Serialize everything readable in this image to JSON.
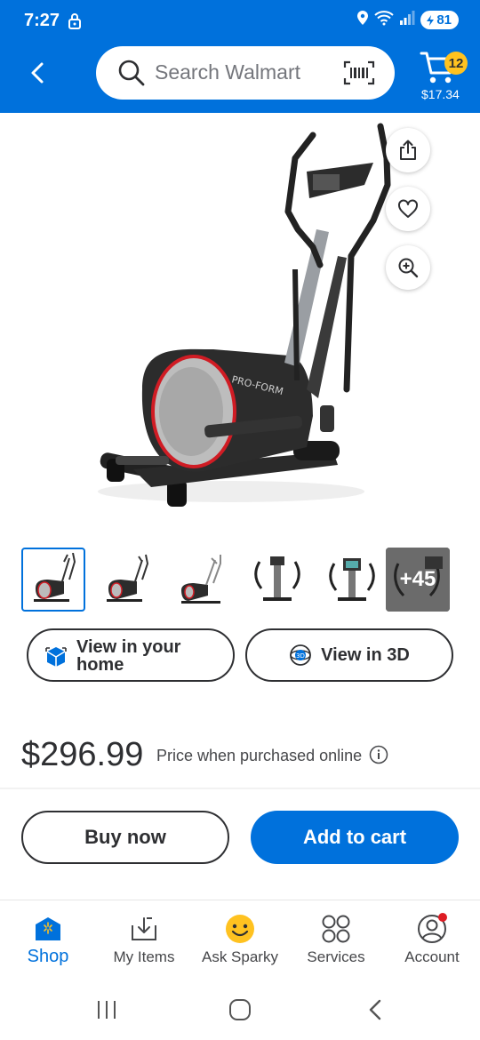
{
  "status_bar": {
    "time": "7:27",
    "battery": "81"
  },
  "header": {
    "search": {
      "placeholder": "Search Walmart"
    },
    "cart": {
      "count": "12",
      "total": "$17.34"
    }
  },
  "product": {
    "image_brand": "PRO-FORM",
    "thumbnails_more": "+45",
    "view_in_home": "View in your home",
    "view_in_3d": "View in 3D",
    "price": "$296.99",
    "price_note": "Price when purchased online",
    "buy_now": "Buy now",
    "add_to_cart": "Add to cart"
  },
  "bottom_nav": {
    "items": [
      {
        "label": "Shop",
        "icon": "shop-icon",
        "active": true
      },
      {
        "label": "My Items",
        "icon": "my-items-icon"
      },
      {
        "label": "Ask Sparky",
        "icon": "sparky-icon"
      },
      {
        "label": "Services",
        "icon": "services-icon"
      },
      {
        "label": "Account",
        "icon": "account-icon"
      }
    ]
  },
  "colors": {
    "brand_blue": "#0071dc",
    "cart_badge": "#ffc220",
    "notify_dot": "#de1c24"
  }
}
